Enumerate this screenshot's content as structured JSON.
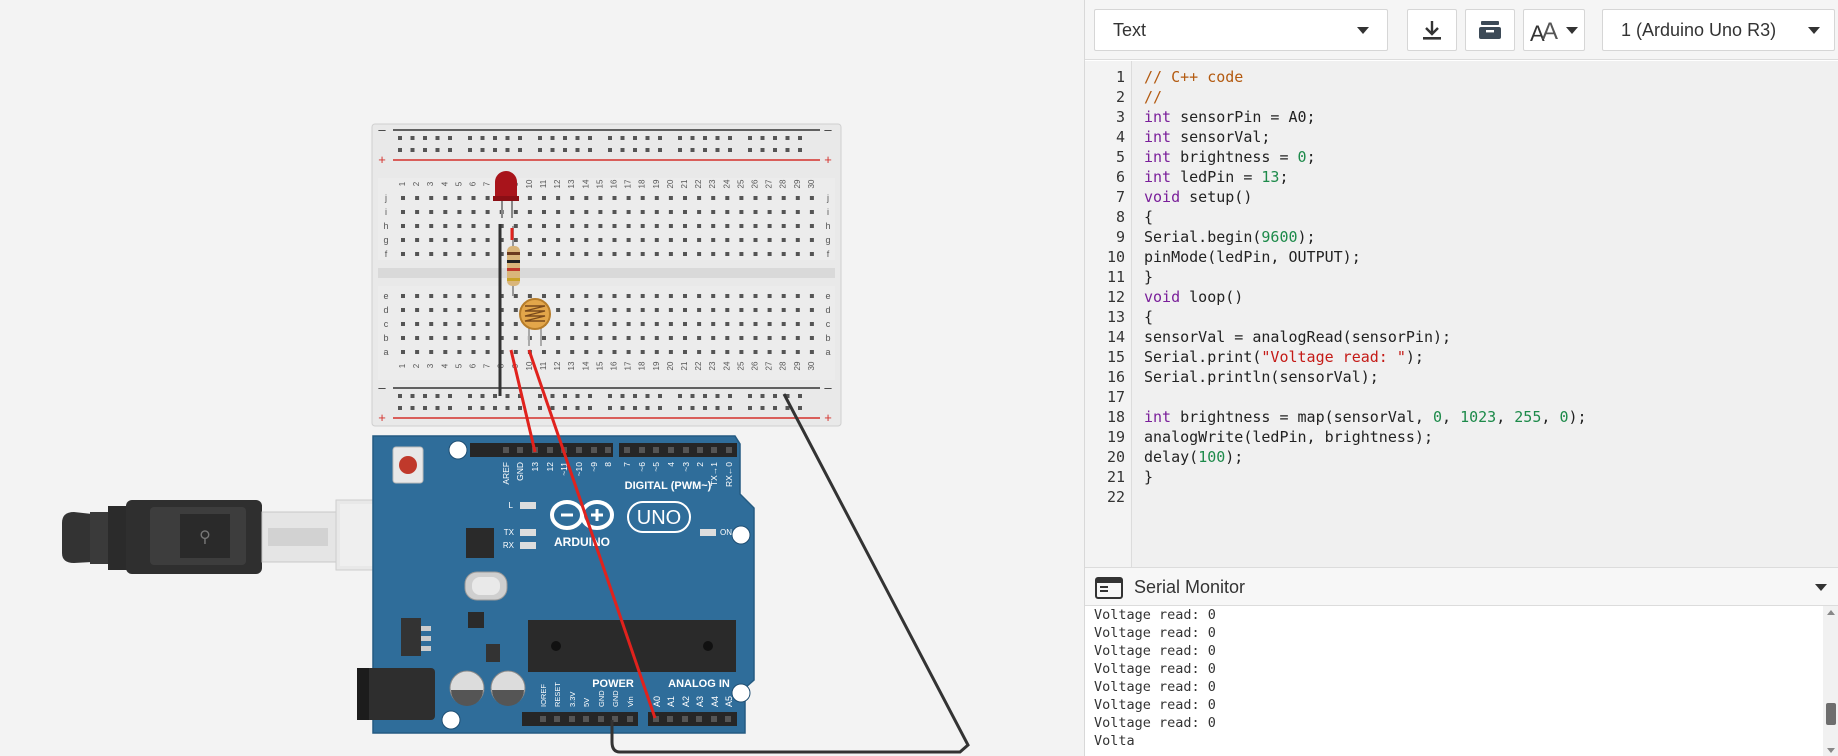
{
  "toolbar": {
    "mode_label": "Text",
    "download_icon": "download-icon",
    "library_icon": "library-icon",
    "font_icon": "font-size-icon",
    "board_label": "1 (Arduino Uno R3)"
  },
  "editor": {
    "line_numbers": [
      "1",
      "2",
      "3",
      "4",
      "5",
      "6",
      "7",
      "8",
      "9",
      "10",
      "11",
      "12",
      "13",
      "14",
      "15",
      "16",
      "17",
      "18",
      "19",
      "20",
      "21",
      "22"
    ],
    "lines": [
      "// C++ code",
      "//",
      "int sensorPin = A0;",
      "int sensorVal;",
      "int brightness = 0;",
      "int ledPin = 13;",
      "void setup()",
      "{",
      "Serial.begin(9600);",
      "pinMode(ledPin, OUTPUT);",
      "}",
      "void loop()",
      "{",
      "sensorVal = analogRead(sensorPin);",
      "Serial.print(\"Voltage read: \");",
      "Serial.println(sensorVal);",
      "",
      "int brightness = map(sensorVal, 0, 1023, 255, 0);",
      "analogWrite(ledPin, brightness);",
      "delay(100);",
      "}",
      ""
    ]
  },
  "serial": {
    "title": "Serial Monitor",
    "lines": [
      "Voltage read: 0",
      "Voltage read: 0",
      "Voltage read: 0",
      "Voltage read: 0",
      "Voltage read: 0",
      "Voltage read: 0",
      "Voltage read: 0",
      "Volta"
    ]
  },
  "circuit": {
    "breadboard": {
      "minus": "–",
      "plus": "+",
      "row_letters_top": [
        "j",
        "i",
        "h",
        "g",
        "f"
      ],
      "row_letters_bottom": [
        "e",
        "d",
        "c",
        "b",
        "a"
      ],
      "columns": [
        "1",
        "2",
        "3",
        "4",
        "5",
        "6",
        "7",
        "8",
        "9",
        "10",
        "11",
        "12",
        "13",
        "14",
        "15",
        "16",
        "17",
        "18",
        "19",
        "20",
        "21",
        "22",
        "23",
        "24",
        "25",
        "26",
        "27",
        "28",
        "29",
        "30"
      ]
    },
    "arduino": {
      "brand": "ARDUINO",
      "model": "UNO",
      "digital_label": "DIGITAL (PWM~)",
      "power_label": "POWER",
      "analog_label": "ANALOG IN",
      "led_l": "L",
      "led_tx": "TX",
      "led_rx": "RX",
      "led_on": "ON",
      "top_pins": [
        "AREF",
        "GND",
        "13",
        "12",
        "~11",
        "~10",
        "~9",
        "8",
        "7",
        "~6",
        "~5",
        "4",
        "~3",
        "2",
        "TX→1",
        "RX←0"
      ],
      "power_pins": [
        "IOREF",
        "RESET",
        "3.3V",
        "5V",
        "GND",
        "GND",
        "Vin"
      ],
      "analog_pins": [
        "A0",
        "A1",
        "A2",
        "A3",
        "A4",
        "A5"
      ]
    },
    "colors": {
      "board_blue": "#2f6d9a",
      "wire_red": "#e0221d",
      "wire_black": "#333333",
      "rail_red": "#d4302b"
    }
  }
}
